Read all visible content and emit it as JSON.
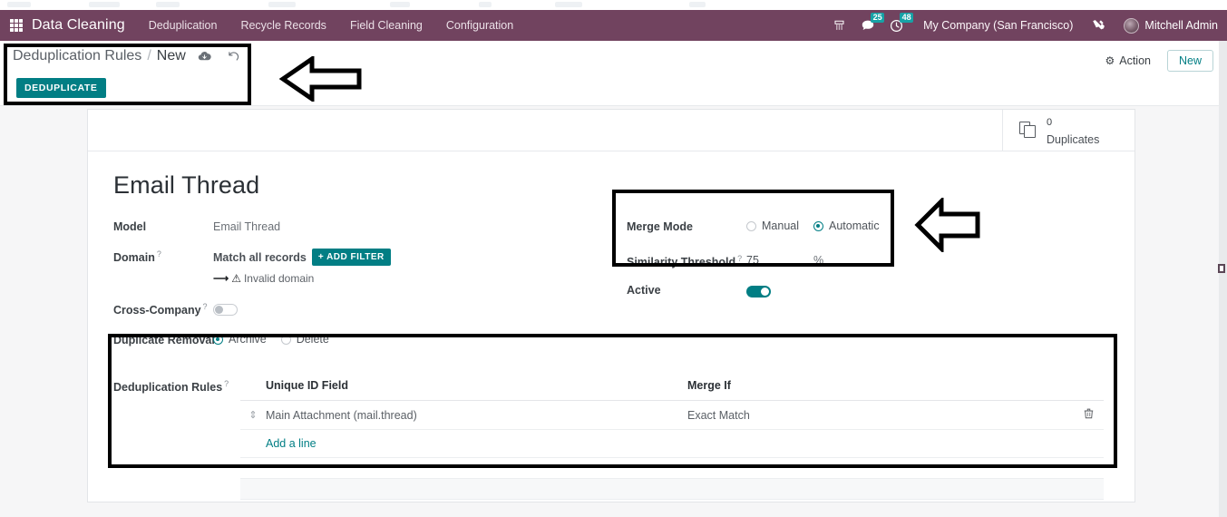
{
  "navbar": {
    "apps_icon": "apps-grid-icon",
    "brand": "Data Cleaning",
    "menu": [
      {
        "label": "Deduplication"
      },
      {
        "label": "Recycle Records"
      },
      {
        "label": "Field Cleaning"
      },
      {
        "label": "Configuration"
      }
    ],
    "phone_icon": "phone-icon",
    "messages": {
      "icon": "chat-icon",
      "count": "25"
    },
    "activities": {
      "icon": "clock-icon",
      "count": "48"
    },
    "company": "My Company (San Francisco)",
    "debug_icon": "wrench-icon",
    "user": "Mitchell Admin",
    "avatar": "user-avatar",
    "accent_badge_color": "#17a2a6",
    "navbar_color": "#71435f"
  },
  "control_panel": {
    "breadcrumb_parent": "Deduplication Rules",
    "breadcrumb_separator": "/",
    "breadcrumb_current": "New",
    "save_icon": "cloud-save-icon",
    "discard_icon": "discard-undo-icon",
    "status_button": "DEDUPLICATE",
    "action_label": "Action",
    "action_icon": "gear-icon",
    "new_label": "New",
    "accent_color": "#017e84"
  },
  "stat_buttons": [
    {
      "icon": "duplicate-copy-icon",
      "value": "0",
      "label": "Duplicates"
    }
  ],
  "form": {
    "record_title": "Email Thread",
    "left": {
      "model_label": "Model",
      "model_value": "Email Thread",
      "domain_label": "Domain",
      "domain_help": "?",
      "domain_value": "Match all records",
      "add_filter_label": "+ ADD FILTER",
      "invalid_domain": "Invalid domain",
      "invalid_arrow_icon": "arrow-right-icon",
      "invalid_warning_icon": "warning-triangle-icon",
      "cross_company_label": "Cross-Company",
      "cross_company_help": "?",
      "cross_company_state": "off",
      "duplicate_removal_label": "Duplicate Removal",
      "duplicate_removal_options": [
        {
          "label": "Archive",
          "selected": true
        },
        {
          "label": "Delete",
          "selected": false
        }
      ]
    },
    "right": {
      "merge_mode_label": "Merge Mode",
      "merge_mode_options": [
        {
          "label": "Manual",
          "selected": false
        },
        {
          "label": "Automatic",
          "selected": true
        }
      ],
      "similarity_label": "Similarity Threshold",
      "similarity_help": "?",
      "similarity_value": "75",
      "similarity_unit": "%",
      "active_label": "Active",
      "active_state": "on"
    },
    "o2m": {
      "label": "Deduplication Rules",
      "label_help": "?",
      "columns": [
        "",
        "Unique ID Field",
        "Merge If",
        ""
      ],
      "rows": [
        {
          "handle_icon": "drag-handle-icon",
          "unique_id_field": "Main Attachment (mail.thread)",
          "merge_if": "Exact Match",
          "delete_icon": "trash-icon"
        }
      ],
      "add_line_label": "Add a line"
    }
  },
  "annotations": {
    "highlight_boxes": [
      "breadcrumb-area",
      "merge-mode-area",
      "deduplication-rules-area"
    ],
    "arrows": [
      "arrow-pointing-left-at-breadcrumb",
      "arrow-pointing-left-at-merge-mode"
    ],
    "highlight_color": "#000000"
  }
}
